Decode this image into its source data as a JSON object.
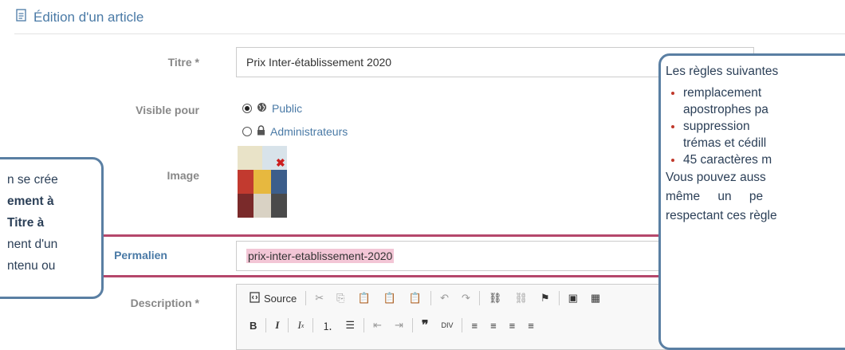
{
  "header": {
    "title": "Édition d'un article",
    "icon": "document-icon"
  },
  "form": {
    "title_label": "Titre *",
    "title_value": "Prix Inter-établissement 2020",
    "visibility_label": "Visible pour",
    "visibility_options": [
      {
        "label": "Public",
        "icon": "globe-icon",
        "checked": true
      },
      {
        "label": "Administrateurs",
        "icon": "lock-icon",
        "checked": false
      }
    ],
    "image_label": "Image",
    "permalink_label": "Permalien",
    "permalink_value": "prix-inter-etablissement-2020",
    "description_label": "Description *",
    "source_label": "Source"
  },
  "callout_left": {
    "lines": [
      "n se crée",
      "ement à",
      "Titre à",
      "nent d'un",
      "ntenu ou"
    ]
  },
  "callout_right": {
    "intro": "Les règles suivantes",
    "rules": [
      "remplacement",
      "apostrophes pa",
      "suppression",
      "trémas et cédill",
      "45 caractères m"
    ],
    "outro1": "Vous pouvez auss",
    "outro2": "même un pe",
    "outro3": "respectant ces règle"
  },
  "colors": {
    "accent": "#4a7aa6",
    "callout_border": "#5a7fa3",
    "highlight_border": "#b5476b",
    "highlight_fill": "#f3c6d6"
  }
}
